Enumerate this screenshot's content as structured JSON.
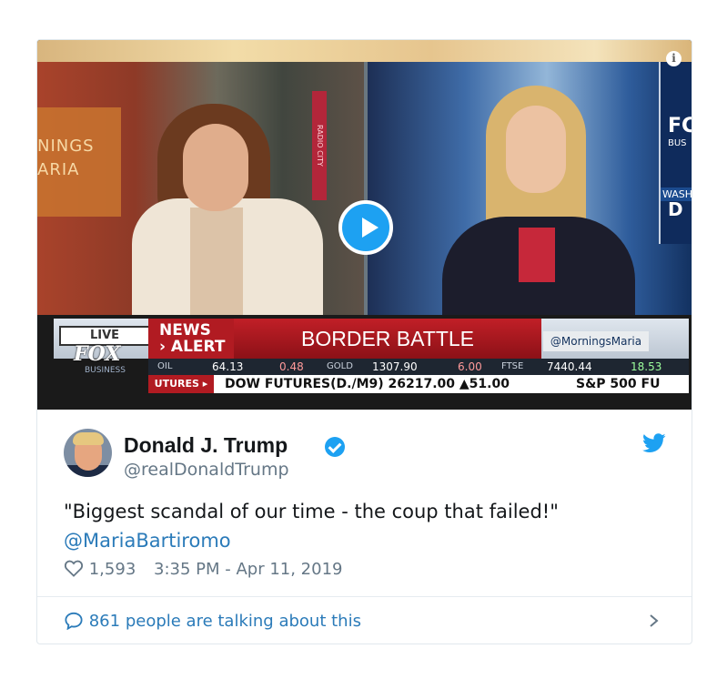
{
  "video": {
    "info_icon": "info-icon",
    "play_icon": "play-icon",
    "left_show_text_1": "NINGS",
    "left_show_text_2": "ARIA",
    "radio_sign": "RADIO CITY",
    "right_logo_top": "FC",
    "right_logo_sub": "BUS",
    "right_wash": "WASH",
    "right_d": "D",
    "chyron": {
      "live": "LIVE",
      "network": "FOX",
      "network_sub": "BUSINESS",
      "alert_line1": "NEWS",
      "alert_line2": "› ALERT",
      "headline": "BORDER BATTLE",
      "handle": "@MorningsMaria",
      "ticker": {
        "oil_label": "OIL",
        "oil_value": "64.13",
        "oil_change": "0.48",
        "gold_label": "GOLD",
        "gold_value": "1307.90",
        "gold_change": "6.00",
        "ftse_label": "FTSE",
        "ftse_value": "7440.44",
        "ftse_change": "18.53"
      },
      "futures_tag": "UTURES ▸",
      "futures_text": "DOW FUTURES(D./M9) 26217.00 ▲51.00",
      "sp_text": "S&P 500 FU"
    }
  },
  "tweet": {
    "author_name": "Donald J. Trump",
    "author_handle": "@realDonaldTrump",
    "text": "\"Biggest scandal of our time - the coup that failed!\"",
    "mention": "@MariaBartiromo",
    "likes": "1,593",
    "timestamp": "3:35 PM - Apr 11, 2019",
    "talking": "861 people are talking about this",
    "colors": {
      "accent": "#1da1f2",
      "link": "#2b7bb9",
      "muted": "#657786"
    }
  }
}
